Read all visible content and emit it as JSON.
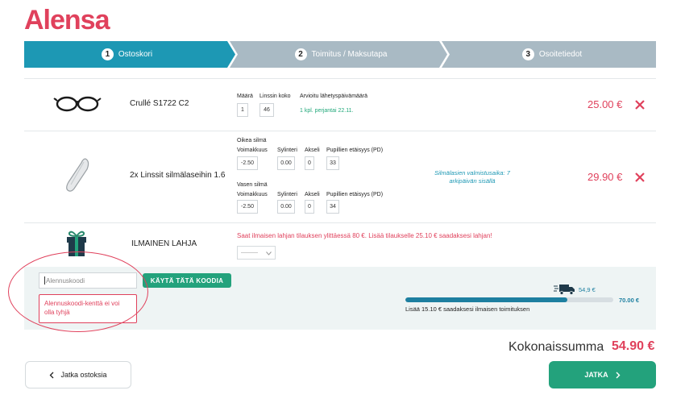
{
  "brand": {
    "logo_text": "Alensa",
    "accent": "#e0415c",
    "green": "#23a27c",
    "step_active": "#1d98b4",
    "step_inactive": "#a9bac4"
  },
  "steps": [
    {
      "num": "1",
      "label": "Ostoskori",
      "active": true
    },
    {
      "num": "2",
      "label": "Toimitus / Maksutapa",
      "active": false
    },
    {
      "num": "3",
      "label": "Osoitetiedot",
      "active": false
    }
  ],
  "item1": {
    "name": "Crullé S1722 C2",
    "qty_label": "Määrä",
    "lens_label": "Linssin koko",
    "ship_label": "Arvioitu lähetyspäivämäärä",
    "qty": "1",
    "lens_size": "46",
    "ship_value": "1 kpl. perjantai 22.11.",
    "price": "25.00 €"
  },
  "item2": {
    "name": "2x Linssit silmälaseihin 1.6",
    "right_eye": "Oikea silmä",
    "left_eye": "Vasen silmä",
    "headers": [
      "Voimakkuus",
      "Sylinteri",
      "Akseli",
      "Pupillien etäisyys (PD)"
    ],
    "right_values": [
      "-2.50",
      "0.00",
      "0",
      "33"
    ],
    "left_values": [
      "-2.50",
      "0.00",
      "0",
      "34"
    ],
    "note_line1": "Silmälasien valmistusaika: 7",
    "note_line2": "arkipäivän sisällä",
    "price": "29.90 €"
  },
  "gift": {
    "label": "ILMAINEN LAHJA",
    "message": "Saat ilmaisen lahjan tilauksen ylittäessä 80 €. Lisää tilaukselle 25.10 € saadaksesi lahjan!",
    "select_value": "———"
  },
  "coupon": {
    "placeholder": "Alennuskoodi",
    "button": "KÄYTÄ TÄTÄ KOODIA",
    "error": "Alennuskoodi-kenttä ei voi olla tyhjä"
  },
  "shipping": {
    "current": "54,9 €",
    "target": "70.00 €",
    "progress": 0.78,
    "message": "Lisää 15.10 € saadaksesi ilmaisen toimituksen"
  },
  "total": {
    "label": "Kokonaissumma",
    "value": "54.90 €"
  },
  "buttons": {
    "back": "Jatka ostoksia",
    "next": "JATKA"
  }
}
